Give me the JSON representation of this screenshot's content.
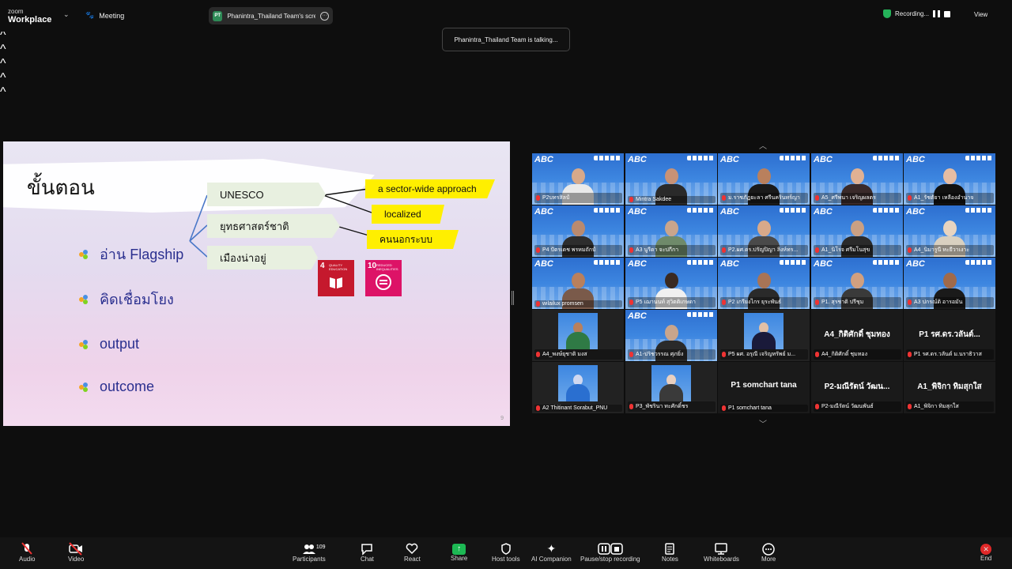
{
  "app": {
    "logo_line1": "zoom",
    "logo_line2": "Workplace",
    "meeting_label": "Meeting"
  },
  "share": {
    "badge": "PT",
    "label": "Phanintra_Thailand Team's scree"
  },
  "recording": {
    "label": "Recording..."
  },
  "view_label": "View",
  "talking_label": "Phanintra_Thailand Team is talking...",
  "slide": {
    "title": "ขั้นตอน",
    "bullets": [
      "อ่าน Flagship",
      "คิดเชื่อมโยง",
      "output",
      "outcome"
    ],
    "map_boxes": [
      "UNESCO",
      "ยุทธศาสตร์ชาติ",
      "เมืองน่าอยู่"
    ],
    "yellow_labels": [
      "a sector-wide approach",
      "localized",
      "คนนอกระบบ"
    ],
    "sdg": [
      {
        "num": "4",
        "text": "QUALITY EDUCATION",
        "color": "#c5192d"
      },
      {
        "num": "10",
        "text": "REDUCED INEQUALITIES",
        "color": "#dd1367"
      }
    ],
    "page_number": "9"
  },
  "gallery": {
    "tiles": [
      {
        "name": "P2บทรสิลป์",
        "type": "video",
        "skin": "#d7a98a",
        "shirt": "#e9e9e9"
      },
      {
        "name": "Mintra Sakdee",
        "type": "video",
        "skin": "#c89276",
        "shirt": "#2a2a2a"
      },
      {
        "name": "ม.ราชภัฏยะลา ศรีนครินทร์ญา",
        "type": "video",
        "skin": "#b9805d",
        "shirt": "#1a1a1a"
      },
      {
        "name": "A5_ศรีพนา เจริญผลตร",
        "type": "video",
        "skin": "#e0b193",
        "shirt": "#3a2a2a"
      },
      {
        "name": "A1_รัชตัยา เหลืองอำนาจ",
        "type": "video",
        "skin": "#e6bda3",
        "shirt": "#111111"
      },
      {
        "name": "P4 ปัตรเดช พรหมถักป์",
        "type": "video",
        "skin": "#b98a6f",
        "shirt": "#2d2d2d"
      },
      {
        "name": "A3 นูรีดา จะปกีกา",
        "type": "video",
        "skin": "#c9a58c",
        "shirt": "#6f8a6a"
      },
      {
        "name": "P2.ผศ.ดร.ปรัญปิญา ลิงห์ทร...",
        "type": "video",
        "skin": "#d8a98a",
        "shirt": "#4a4a4a"
      },
      {
        "name": "A1_นิโรจ ศรีมโนสุข",
        "type": "video",
        "skin": "#caa083",
        "shirt": "#2a2a2a"
      },
      {
        "name": "A4_นิมารูนี หะยีวาเงาะ",
        "type": "video",
        "skin": "#e8d4c0",
        "shirt": "#d9d0c0"
      },
      {
        "name": "wilailux promsen",
        "type": "video",
        "skin": "#b9805d",
        "shirt": "#7a5a4a"
      },
      {
        "name": "P5 เฌานนท์ สุวิตติเกษดา",
        "type": "video",
        "skin": "#3a2a22",
        "shirt": "#f0f0f0"
      },
      {
        "name": "P2 เกรียงไกร ยุระพันธ์",
        "type": "video",
        "skin": "#a87456",
        "shirt": "#2a2a2a"
      },
      {
        "name": "P1. สุรชาติ ปรีชุม",
        "type": "video",
        "skin": "#d0a080",
        "shirt": "#3a3a3a"
      },
      {
        "name": "A3 ปกรณ์ติ อารอมัน",
        "type": "video",
        "skin": "#a06a4a",
        "shirt": "#1a1a1a"
      },
      {
        "name": "A4_พงษ์ยุชาติ มงส",
        "type": "small",
        "skin": "#b9805d",
        "shirt": "#2f7a45"
      },
      {
        "name": "A1-ปริชวรรณ ศุภยิ่ง",
        "type": "video",
        "skin": "#c9a58c",
        "shirt": "#2a2a2a"
      },
      {
        "name": "P5 ผศ. อรุณี เจริญทรัพย์ ม...",
        "type": "small",
        "skin": "#e2c0a6",
        "shirt": "#1a1a3a"
      },
      {
        "name": "A4_กิติศักดิ์ ชุมทอง",
        "type": "name",
        "big": "A4_กิติศักดิ์ ชุมทอง"
      },
      {
        "name": "P1 รศ.ดร.วลันต์ ม.นราธิวาส",
        "type": "name",
        "big": "P1 รศ.ดร.วลันต์..."
      },
      {
        "name": "A2 Thitinant Sorabut_PNU",
        "type": "small",
        "skin": "#d0d8f0",
        "shirt": "#2a6fd0"
      },
      {
        "name": "P3_พัชรินา ทะศักดิ์ชร",
        "type": "small",
        "skin": "#e9d0c0",
        "shirt": "#3a3a3a"
      },
      {
        "name": "P1 somchart tana",
        "type": "name",
        "big": "P1 somchart tana"
      },
      {
        "name": "P2-มณีรัตน์ วัฒนพันธ์",
        "type": "name",
        "big": "P2-มณีรัตน์ วัฒน..."
      },
      {
        "name": "A1_พิจิกา ทิมสุกใส",
        "type": "name",
        "big": "A1_พิจิกา ทิมสุกใส"
      }
    ]
  },
  "toolbar": {
    "audio": "Audio",
    "video": "Video",
    "participants": "Participants",
    "participants_count": "109",
    "chat": "Chat",
    "react": "React",
    "share": "Share",
    "host_tools": "Host tools",
    "ai_companion": "AI Companion",
    "pause_recording": "Pause/stop recording",
    "notes": "Notes",
    "whiteboards": "Whiteboards",
    "more": "More",
    "end": "End"
  },
  "colors": {
    "accent_green": "#1db954",
    "end_red": "#e02828",
    "slide_text": "#2a2f8f",
    "yellow": "#ffef00"
  }
}
